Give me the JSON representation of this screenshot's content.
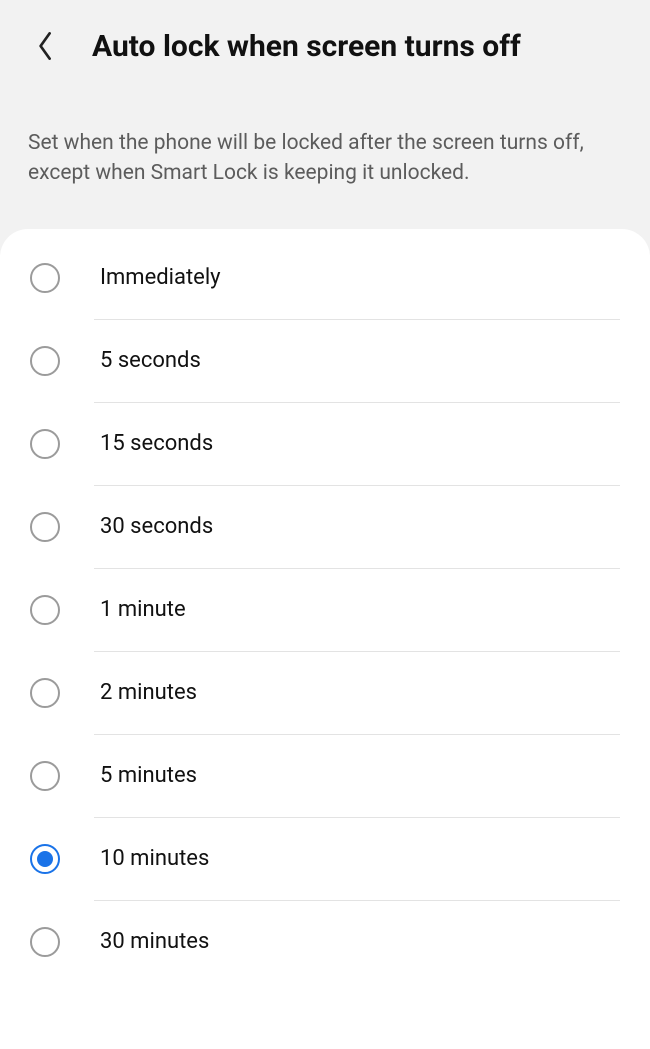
{
  "header": {
    "title": "Auto lock when screen turns off"
  },
  "description": "Set when the phone will be locked after the screen turns off, except when Smart Lock is keeping it unlocked.",
  "options": [
    {
      "label": "Immediately",
      "selected": false
    },
    {
      "label": "5 seconds",
      "selected": false
    },
    {
      "label": "15 seconds",
      "selected": false
    },
    {
      "label": "30 seconds",
      "selected": false
    },
    {
      "label": "1 minute",
      "selected": false
    },
    {
      "label": "2 minutes",
      "selected": false
    },
    {
      "label": "5 minutes",
      "selected": false
    },
    {
      "label": "10 minutes",
      "selected": true
    },
    {
      "label": "30 minutes",
      "selected": false
    }
  ]
}
